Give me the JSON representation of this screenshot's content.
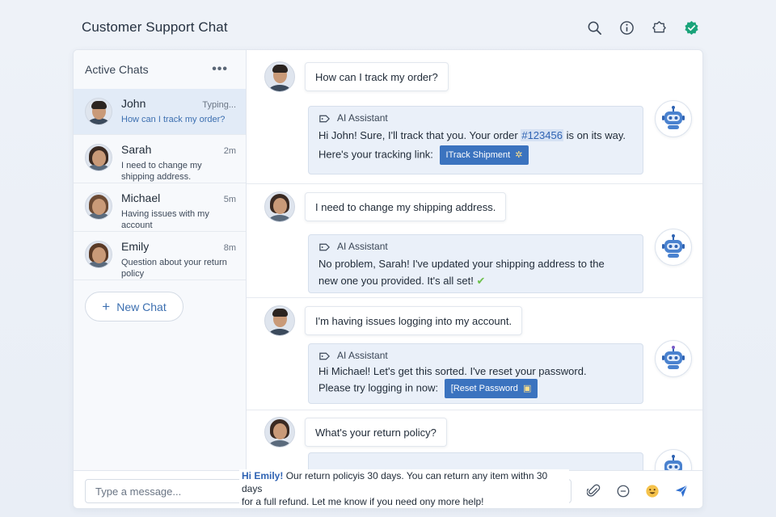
{
  "app": {
    "title": "Customer Support Chat"
  },
  "top_icons": [
    "search-icon",
    "info-icon",
    "settings-icon",
    "verified-icon"
  ],
  "sidebar": {
    "title": "Active Chats",
    "more": "•••",
    "chats": [
      {
        "name": "John",
        "time": "Typing...",
        "preview": "How can I track my order?"
      },
      {
        "name": "Sarah",
        "time": "2m",
        "preview": "I need to change my shipping address."
      },
      {
        "name": "Michael",
        "time": "5m",
        "preview": "Having issues with my account"
      },
      {
        "name": "Emily",
        "time": "8m",
        "preview": "Question about your return policy"
      }
    ],
    "new_chat": "New Chat"
  },
  "conversations": [
    {
      "user_message": "How can I track my order?",
      "assistant_label": "AI Assistant",
      "reply_pre": "Hi John! Sure, I'll track that you. Your order ",
      "order_number": "#123456",
      "reply_post": " is on its way.",
      "reply_line2": "Here's your tracking link:",
      "button": "ITrack Shipment"
    },
    {
      "user_message": "I need to change my shipping address.",
      "assistant_label": "AI Assistant",
      "reply": "No problem, Sarah! I've updated your shipping address to the new one you provided. It's all set!"
    },
    {
      "user_message": "I'm having issues logging into my account.",
      "assistant_label": "AI Assistant",
      "reply_line1": "Hi Michael! Let's get this sorted. I've reset your password.",
      "reply_line2": "Please try logging in now:",
      "button": "[Reset Password"
    },
    {
      "user_message": "What's your return policy?",
      "reply_greeting": "Hi Emily!",
      "reply": " Our return policyis 30 days. You can return any item withn 30 days",
      "reply_line2": "for a full refund. Let me know if you need ony more help!"
    }
  ],
  "composer": {
    "placeholder": "Type a message..."
  },
  "colors": {
    "accent": "#3b73bf",
    "active_row": "#e2ebf7",
    "ai_bubble": "#eaf0f9",
    "verified": "#1aa37a"
  }
}
